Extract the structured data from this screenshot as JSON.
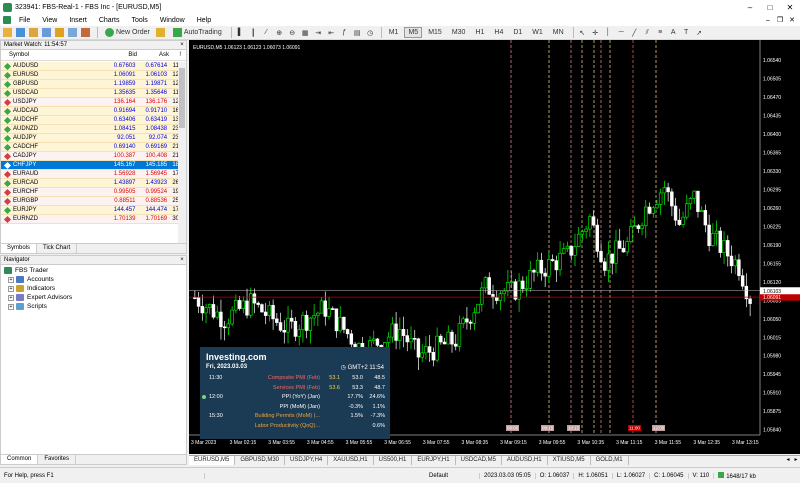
{
  "window": {
    "title": "323941: FBS-Real-1 - FBS Inc - [EURUSD,M5]"
  },
  "menu": [
    "File",
    "View",
    "Insert",
    "Charts",
    "Tools",
    "Window",
    "Help"
  ],
  "toolbar": {
    "new_order": "New Order",
    "autotrading": "AutoTrading",
    "periods": [
      "M1",
      "M5",
      "M15",
      "M30",
      "H1",
      "H4",
      "D1",
      "W1",
      "MN"
    ],
    "active_period": "M5"
  },
  "market_watch": {
    "title": "Market Watch: 11:54:57",
    "columns": [
      "Symbol",
      "Bid",
      "Ask",
      "!"
    ],
    "rows": [
      {
        "symbol": "AUDUSD",
        "bid": "0.67603",
        "ask": "0.67614",
        "spread": "11",
        "dir": "up"
      },
      {
        "symbol": "EURUSD",
        "bid": "1.06091",
        "ask": "1.06103",
        "spread": "12",
        "dir": "up"
      },
      {
        "symbol": "GBPUSD",
        "bid": "1.19859",
        "ask": "1.19871",
        "spread": "12",
        "dir": "up"
      },
      {
        "symbol": "USDCAD",
        "bid": "1.35635",
        "ask": "1.35646",
        "spread": "11",
        "dir": "up"
      },
      {
        "symbol": "USDJPY",
        "bid": "136.164",
        "ask": "136.176",
        "spread": "12",
        "dir": "dn"
      },
      {
        "symbol": "AUDCAD",
        "bid": "0.91694",
        "ask": "0.91710",
        "spread": "16",
        "dir": "up"
      },
      {
        "symbol": "AUDCHF",
        "bid": "0.63406",
        "ask": "0.63419",
        "spread": "13",
        "dir": "up"
      },
      {
        "symbol": "AUDNZD",
        "bid": "1.08415",
        "ask": "1.08438",
        "spread": "23",
        "dir": "up"
      },
      {
        "symbol": "AUDJPY",
        "bid": "92.051",
        "ask": "92.074",
        "spread": "23",
        "dir": "up"
      },
      {
        "symbol": "CADCHF",
        "bid": "0.69140",
        "ask": "0.69169",
        "spread": "21",
        "dir": "up"
      },
      {
        "symbol": "CADJPY",
        "bid": "100.387",
        "ask": "100.408",
        "spread": "21",
        "dir": "dn"
      },
      {
        "symbol": "CHFJPY",
        "bid": "145.167",
        "ask": "145.185",
        "spread": "18",
        "dir": "sel"
      },
      {
        "symbol": "EURAUD",
        "bid": "1.56928",
        "ask": "1.56945",
        "spread": "17",
        "dir": "dn"
      },
      {
        "symbol": "EURCAD",
        "bid": "1.43897",
        "ask": "1.43923",
        "spread": "26",
        "dir": "up"
      },
      {
        "symbol": "EURCHF",
        "bid": "0.99505",
        "ask": "0.99524",
        "spread": "19",
        "dir": "dn"
      },
      {
        "symbol": "EURGBP",
        "bid": "0.88511",
        "ask": "0.88536",
        "spread": "25",
        "dir": "dn"
      },
      {
        "symbol": "EURJPY",
        "bid": "144.457",
        "ask": "144.474",
        "spread": "17",
        "dir": "up"
      },
      {
        "symbol": "EURNZD",
        "bid": "1.70139",
        "ask": "1.70169",
        "spread": "30",
        "dir": "dn"
      }
    ],
    "tabs": [
      "Symbols",
      "Tick Chart"
    ]
  },
  "navigator": {
    "title": "Navigator",
    "items": [
      "FBS Trader",
      "Accounts",
      "Indicators",
      "Expert Advisors",
      "Scripts"
    ],
    "tabs": [
      "Common",
      "Favorites"
    ]
  },
  "chart": {
    "header": "EURUSD,M5  1.06123 1.06123 1.06073 1.06091",
    "price_labels": [
      "1.06540",
      "1.06505",
      "1.06470",
      "1.06435",
      "1.06400",
      "1.06365",
      "1.06330",
      "1.06295",
      "1.06260",
      "1.06225",
      "1.06190",
      "1.06155",
      "1.06120",
      "1.06085",
      "1.06050",
      "1.06015",
      "1.05980",
      "1.05945",
      "1.05910",
      "1.05875",
      "1.05840"
    ],
    "price_range": [
      1.0583,
      1.0657
    ],
    "current_bid": "1.06091",
    "ask_line_price": "1.06103",
    "time_labels": [
      "3 Mar 2023",
      "3 Mar 02:15",
      "3 Mar 03:55",
      "3 Mar 04:55",
      "3 Mar 05:55",
      "3 Mar 06:55",
      "3 Mar 07:55",
      "3 Mar 08:35",
      "3 Mar 09:15",
      "3 Mar 09:55",
      "3 Mar 10:35",
      "3 Mar 11:15",
      "3 Mar 11:55",
      "3 Mar 12:35",
      "3 Mar 13:15"
    ],
    "event_marks": [
      "08:00",
      "09:15",
      "10:15",
      "11:00",
      "12:00"
    ],
    "colors": {
      "bull": "#00ff00",
      "bear": "#ffffff",
      "bid_line": "#c00000",
      "ask_line": "#c0c0c0",
      "grid": "#000000"
    }
  },
  "investing": {
    "logo": "Investing.com",
    "date": "Fri, 2023.03.03",
    "gmt": "GMT+2 11:54",
    "rows": [
      {
        "time": "11:30",
        "event": "Composite PMI (Feb)",
        "actual": "53.1",
        "forecast": "53.0",
        "prev": "48.5",
        "color": "red",
        "dot": false
      },
      {
        "time": "",
        "event": "Services PMI (Feb)",
        "actual": "53.6",
        "forecast": "53.3",
        "prev": "48.7",
        "color": "red",
        "dot": false
      },
      {
        "time": "12:00",
        "event": "PPI (YoY) (Jan)",
        "actual": "",
        "forecast": "17.7%",
        "prev": "24.6%",
        "color": "white",
        "dot": true
      },
      {
        "time": "",
        "event": "PPI (MoM) (Jan)",
        "actual": "",
        "forecast": "-0.3%",
        "prev": "1.1%",
        "color": "white",
        "dot": false
      },
      {
        "time": "15:30",
        "event": "Building Permits (MoM) (...",
        "actual": "",
        "forecast": "1.5%",
        "prev": "-7.3%",
        "color": "orange",
        "dot": false
      },
      {
        "time": "",
        "event": "Labor Productivity (QoQ)...",
        "actual": "",
        "forecast": "",
        "prev": "0.6%",
        "color": "orange",
        "dot": false
      }
    ]
  },
  "chart_tabs": [
    "EURUSD,M5",
    "GBPUSD,M30",
    "USDJPY,H4",
    "XAUUSD,H1",
    "US500,H1",
    "EURJPY,H1",
    "USDCAD,M5",
    "AUDUSD,H1",
    "XTIUSD,M5",
    "GOLD,M1"
  ],
  "status": {
    "help": "For Help, press F1",
    "profile": "Default",
    "time": "2023.03.03 05:05",
    "open": "O: 1.06037",
    "high": "H: 1.06051",
    "low": "L: 1.06027",
    "close": "C: 1.06045",
    "volume": "V: 110",
    "traffic": "1648/17 kb"
  }
}
